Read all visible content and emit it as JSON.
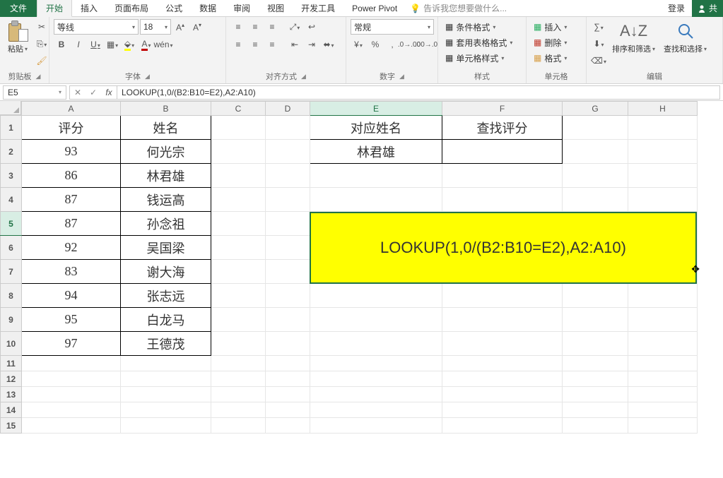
{
  "tabs": {
    "file": "文件",
    "home": "开始",
    "insert": "插入",
    "layout": "页面布局",
    "formulas": "公式",
    "data": "数据",
    "review": "审阅",
    "view": "视图",
    "dev": "开发工具",
    "powerpivot": "Power Pivot",
    "tellme": "告诉我您想要做什么...",
    "login": "登录",
    "share": "共"
  },
  "ribbon": {
    "clipboard": {
      "label": "剪贴板",
      "paste": "粘贴"
    },
    "font": {
      "label": "字体",
      "name": "等线",
      "size": "18"
    },
    "align": {
      "label": "对齐方式"
    },
    "number": {
      "label": "数字",
      "format": "常规"
    },
    "styles": {
      "label": "样式",
      "cond": "条件格式",
      "tablefmt": "套用表格格式",
      "cellstyle": "单元格样式"
    },
    "cells": {
      "label": "单元格",
      "insert": "插入",
      "delete": "删除",
      "format": "格式"
    },
    "editing": {
      "label": "编辑",
      "sort": "排序和筛选",
      "find": "查找和选择"
    }
  },
  "fbar": {
    "namebox": "E5",
    "formula": "LOOKUP(1,0/(B2:B10=E2),A2:A10)"
  },
  "columns": [
    "A",
    "B",
    "C",
    "D",
    "E",
    "F",
    "G",
    "H"
  ],
  "rows": [
    "1",
    "2",
    "3",
    "4",
    "5",
    "6",
    "7",
    "8",
    "9",
    "10",
    "11",
    "12",
    "13",
    "14",
    "15"
  ],
  "data": {
    "a_header": "评分",
    "b_header": "姓名",
    "e_header": "对应姓名",
    "f_header": "查找评分",
    "scores": [
      "93",
      "86",
      "87",
      "87",
      "92",
      "83",
      "94",
      "95",
      "97"
    ],
    "names": [
      "何光宗",
      "林君雄",
      "钱运高",
      "孙念祖",
      "吴国梁",
      "谢大海",
      "张志远",
      "白龙马",
      "王德茂"
    ],
    "e2": "林君雄"
  },
  "yellowbox": "LOOKUP(1,0/(B2:B10=E2),A2:A10)"
}
